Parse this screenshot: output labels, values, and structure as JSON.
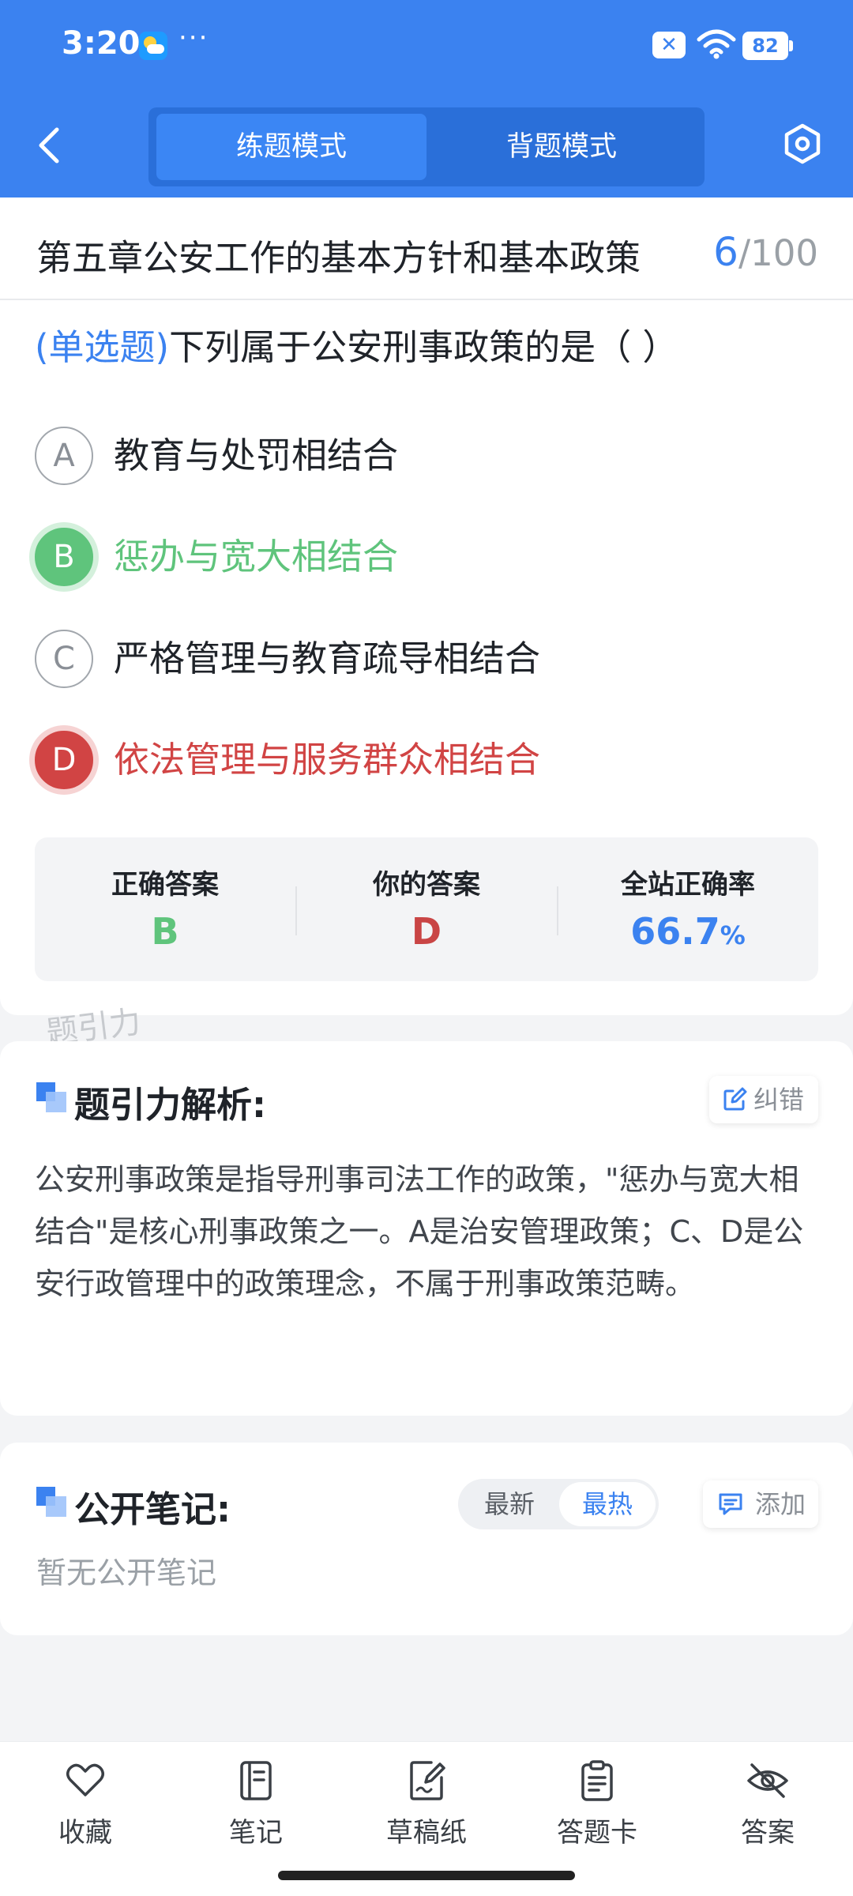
{
  "status_bar": {
    "time": "3:20",
    "dots": "···",
    "battery": "82",
    "notif_icon": "close-box-icon"
  },
  "header": {
    "tabs": [
      {
        "label": "练题模式",
        "active": true
      },
      {
        "label": "背题模式",
        "active": false
      }
    ],
    "accent": "#3b82f0"
  },
  "question_header": {
    "chapter": "第五章公安工作的基本方针和基本政策",
    "current": "6",
    "total": "/100"
  },
  "question": {
    "type": "(单选题)",
    "text": "下列属于公安刑事政策的是（        ）",
    "options": [
      {
        "letter": "A",
        "text": "教育与处罚相结合",
        "state": "normal"
      },
      {
        "letter": "B",
        "text": "惩办与宽大相结合",
        "state": "correct"
      },
      {
        "letter": "C",
        "text": "严格管理与教育疏导相结合",
        "state": "normal"
      },
      {
        "letter": "D",
        "text": "依法管理与服务群众相结合",
        "state": "wrong"
      }
    ]
  },
  "answer_summary": {
    "correct_label": "正确答案",
    "correct_value": "B",
    "yours_label": "你的答案",
    "yours_value": "D",
    "rate_label": "全站正确率",
    "rate_value": "66.7",
    "rate_unit": "%"
  },
  "watermark": "题引力",
  "analysis": {
    "title": "题引力解析:",
    "report_label": "纠错",
    "text": "公安刑事政策是指导刑事司法工作的政策，\"惩办与宽大相结合\"是核心刑事政策之一。A是治安管理政策；C、D是公安行政管理中的政策理念，不属于刑事政策范畴。"
  },
  "notes": {
    "title": "公开笔记:",
    "sort_latest": "最新",
    "sort_hot": "最热",
    "add_label": "添加",
    "empty": "暂无公开笔记"
  },
  "bottom_nav": {
    "items": [
      {
        "label": "收藏",
        "icon": "heart-icon"
      },
      {
        "label": "笔记",
        "icon": "notebook-icon"
      },
      {
        "label": "草稿纸",
        "icon": "draft-paper-icon"
      },
      {
        "label": "答题卡",
        "icon": "answer-sheet-icon"
      },
      {
        "label": "答案",
        "icon": "eye-off-icon"
      }
    ]
  },
  "colors": {
    "correct": "#5fc47c",
    "wrong": "#d14444",
    "primary": "#3b82f0"
  }
}
